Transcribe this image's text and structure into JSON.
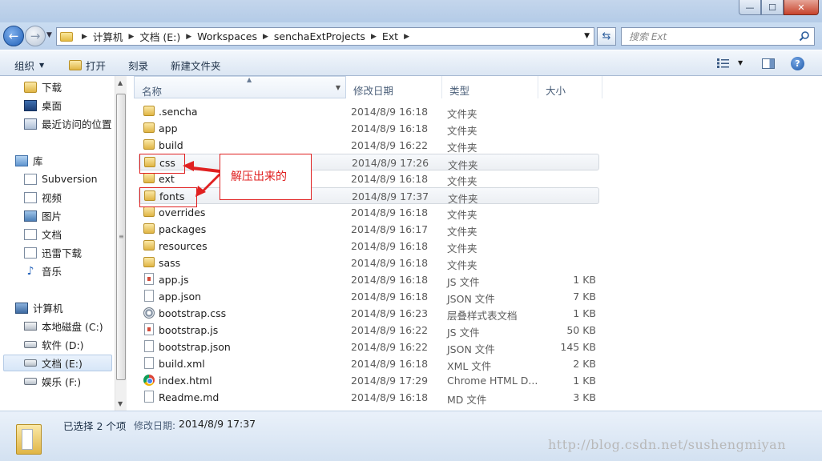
{
  "window": {
    "title": "",
    "buttons": [
      "—",
      "☐",
      "✕"
    ]
  },
  "address": {
    "crumbs": [
      "计算机",
      "文档 (E:)",
      "Workspaces",
      "senchaExtProjects",
      "Ext"
    ],
    "search_placeholder": "搜索 Ext"
  },
  "toolbar": {
    "organize": "组织",
    "open": "打开",
    "burn": "刻录",
    "new_folder": "新建文件夹"
  },
  "nav": {
    "favorites": [
      {
        "label": "下载",
        "icon": "download-folder-icon"
      },
      {
        "label": "桌面",
        "icon": "desktop-icon"
      },
      {
        "label": "最近访问的位置",
        "icon": "recent-places-icon"
      }
    ],
    "libraries_label": "库",
    "libraries": [
      {
        "label": "Subversion",
        "icon": "library-icon"
      },
      {
        "label": "视频",
        "icon": "video-library-icon"
      },
      {
        "label": "图片",
        "icon": "picture-library-icon"
      },
      {
        "label": "文档",
        "icon": "document-library-icon"
      },
      {
        "label": "迅雷下载",
        "icon": "xunlei-library-icon"
      },
      {
        "label": "音乐",
        "icon": "music-library-icon"
      }
    ],
    "computer_label": "计算机",
    "drives": [
      {
        "label": "本地磁盘 (C:)",
        "icon": "system-drive-icon"
      },
      {
        "label": "软件 (D:)",
        "icon": "drive-icon"
      },
      {
        "label": "文档 (E:)",
        "icon": "drive-icon",
        "selected": true
      },
      {
        "label": "娱乐 (F:)",
        "icon": "drive-icon"
      }
    ]
  },
  "columns": {
    "name": "名称",
    "date": "修改日期",
    "type": "类型",
    "size": "大小"
  },
  "files": [
    {
      "name": ".sencha",
      "date": "2014/8/9 16:18",
      "type": "文件夹",
      "size": "",
      "icon": "folder"
    },
    {
      "name": "app",
      "date": "2014/8/9 16:18",
      "type": "文件夹",
      "size": "",
      "icon": "folder"
    },
    {
      "name": "build",
      "date": "2014/8/9 16:22",
      "type": "文件夹",
      "size": "",
      "icon": "folder"
    },
    {
      "name": "css",
      "date": "2014/8/9 17:26",
      "type": "文件夹",
      "size": "",
      "icon": "folder",
      "selected": true
    },
    {
      "name": "ext",
      "date": "2014/8/9 16:18",
      "type": "文件夹",
      "size": "",
      "icon": "folder"
    },
    {
      "name": "fonts",
      "date": "2014/8/9 17:37",
      "type": "文件夹",
      "size": "",
      "icon": "folder",
      "selected": true
    },
    {
      "name": "overrides",
      "date": "2014/8/9 16:18",
      "type": "文件夹",
      "size": "",
      "icon": "folder"
    },
    {
      "name": "packages",
      "date": "2014/8/9 16:17",
      "type": "文件夹",
      "size": "",
      "icon": "folder"
    },
    {
      "name": "resources",
      "date": "2014/8/9 16:18",
      "type": "文件夹",
      "size": "",
      "icon": "folder"
    },
    {
      "name": "sass",
      "date": "2014/8/9 16:18",
      "type": "文件夹",
      "size": "",
      "icon": "folder"
    },
    {
      "name": "app.js",
      "date": "2014/8/9 16:18",
      "type": "JS 文件",
      "size": "1 KB",
      "icon": "js"
    },
    {
      "name": "app.json",
      "date": "2014/8/9 16:18",
      "type": "JSON 文件",
      "size": "7 KB",
      "icon": "file"
    },
    {
      "name": "bootstrap.css",
      "date": "2014/8/9 16:23",
      "type": "层叠样式表文档",
      "size": "1 KB",
      "icon": "css"
    },
    {
      "name": "bootstrap.js",
      "date": "2014/8/9 16:22",
      "type": "JS 文件",
      "size": "50 KB",
      "icon": "js"
    },
    {
      "name": "bootstrap.json",
      "date": "2014/8/9 16:22",
      "type": "JSON 文件",
      "size": "145 KB",
      "icon": "file"
    },
    {
      "name": "build.xml",
      "date": "2014/8/9 16:18",
      "type": "XML 文件",
      "size": "2 KB",
      "icon": "file"
    },
    {
      "name": "index.html",
      "date": "2014/8/9 17:29",
      "type": "Chrome HTML D...",
      "size": "1 KB",
      "icon": "chrome"
    },
    {
      "name": "Readme.md",
      "date": "2014/8/9 16:18",
      "type": "MD 文件",
      "size": "3 KB",
      "icon": "file"
    }
  ],
  "annotation": {
    "callout": "解压出来的",
    "color": "#e02020"
  },
  "status": {
    "selected": "已选择 2 个项",
    "date_label": "修改日期:",
    "date_value": "2014/8/9 17:37"
  },
  "watermark": "http://blog.csdn.net/sushengmiyan"
}
